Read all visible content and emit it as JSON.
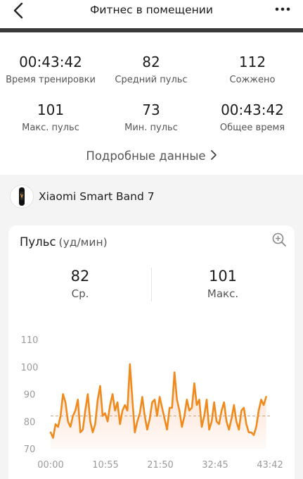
{
  "header": {
    "title": "Фитнес в помещении"
  },
  "summary": {
    "stats": [
      {
        "value": "00:43:42",
        "label": "Время тренировки"
      },
      {
        "value": "82",
        "label": "Средний пульс"
      },
      {
        "value": "112",
        "label": "Сожжено"
      },
      {
        "value": "101",
        "label": "Макс. пульс"
      },
      {
        "value": "73",
        "label": "Мин. пульс"
      },
      {
        "value": "00:43:42",
        "label": "Общее время"
      }
    ],
    "details_link": "Подробные данные"
  },
  "device": {
    "name": "Xiaomi Smart Band 7"
  },
  "heart_card": {
    "title": "Пульс",
    "unit": "(уд/мин)",
    "avg": {
      "value": "82",
      "label": "Ср."
    },
    "max": {
      "value": "101",
      "label": "Макс."
    }
  },
  "colors": {
    "line": "#f08a1c",
    "fill": "#fbd9c6",
    "avg_line": "#d9a07a"
  },
  "chart_data": {
    "type": "area",
    "xlabel": "",
    "ylabel": "",
    "yticks": [
      70,
      80,
      90,
      100,
      110
    ],
    "ylim": [
      70,
      110
    ],
    "xticks": [
      "00:00",
      "10:55",
      "21:50",
      "32:45",
      "43:42"
    ],
    "xlim_minutes": [
      0,
      43.7
    ],
    "avg_line": 82,
    "grid": false,
    "series": [
      {
        "x": [
          0,
          0.5,
          1,
          1.5,
          2,
          2.5,
          3,
          3.5,
          4,
          4.5,
          5,
          5.5,
          6,
          6.5,
          7,
          7.5,
          8,
          8.5,
          9,
          9.5,
          10,
          10.5,
          11,
          11.5,
          12,
          12.5,
          13,
          13.5,
          14,
          14.5,
          15,
          15.5,
          16,
          16.5,
          17,
          17.5,
          18,
          18.5,
          19,
          19.5,
          20,
          20.5,
          21,
          21.5,
          22,
          22.5,
          23,
          23.5,
          24,
          24.5,
          25,
          25.5,
          26,
          26.5,
          27,
          27.5,
          28,
          28.5,
          29,
          29.5,
          30,
          30.5,
          31,
          31.5,
          32,
          32.5,
          33,
          33.5,
          34,
          34.5,
          35,
          35.5,
          36,
          36.5,
          37,
          37.5,
          38,
          38.5,
          39,
          39.5,
          40,
          40.5,
          41,
          41.5,
          42,
          42.5,
          43,
          43.5
        ],
        "values": [
          76,
          74,
          79,
          78,
          82,
          90,
          87,
          80,
          78,
          82,
          84,
          88,
          76,
          77,
          84,
          90,
          80,
          76,
          79,
          88,
          93,
          82,
          83,
          80,
          86,
          90,
          84,
          87,
          79,
          84,
          86,
          84,
          101,
          88,
          76,
          80,
          83,
          89,
          82,
          77,
          81,
          87,
          88,
          82,
          89,
          85,
          81,
          77,
          85,
          85,
          98,
          88,
          84,
          78,
          82,
          88,
          84,
          85,
          94,
          86,
          88,
          78,
          82,
          88,
          77,
          80,
          87,
          80,
          79,
          84,
          87,
          80,
          77,
          81,
          86,
          80,
          77,
          84,
          85,
          79,
          76,
          76,
          75,
          78,
          84,
          88,
          86,
          89
        ]
      }
    ]
  }
}
